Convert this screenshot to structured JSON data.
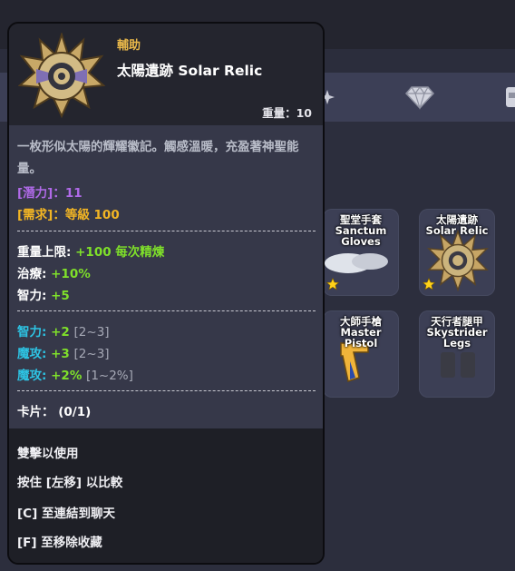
{
  "tooltip": {
    "category": "輔助",
    "item_name": "太陽遺跡 Solar Relic",
    "weight": "重量：10",
    "description": "一枚形似太陽的輝耀徽記。觸感溫暖，充盈著神聖能量。",
    "potential": "[潛力]：11",
    "requirement": "[需求]：等級 100",
    "stats": [
      {
        "label": "重量上限:",
        "value": "+100 每次精煉"
      },
      {
        "label": "治療:",
        "value": "+10%"
      },
      {
        "label": "智力:",
        "value": "+5"
      }
    ],
    "random_stats": [
      {
        "label": "智力:",
        "value": "+2",
        "range": "[2~3]"
      },
      {
        "label": "魔攻:",
        "value": "+3",
        "range": "[2~3]"
      },
      {
        "label": "魔攻:",
        "value": "+2%",
        "range": "[1~2%]"
      }
    ],
    "cards": "卡片： (0/1)",
    "hints": [
      "雙擊以使用",
      "按住 [左移] 以比較",
      "[C] 至連結到聊天",
      "[F] 至移除收藏"
    ]
  },
  "inventory": {
    "slots": [
      {
        "name_line1": "聖堂手套",
        "name_line2": "Sanctum",
        "name_line3": "Gloves",
        "starred": true
      },
      {
        "name_line1": "太陽遺跡",
        "name_line2": "Solar Relic",
        "name_line3": "",
        "starred": true
      },
      {
        "name_line1": "大師手槍",
        "name_line2": "Master Pistol",
        "name_line3": "",
        "starred": false
      },
      {
        "name_line1": "天行者腿甲",
        "name_line2": "Skystrider",
        "name_line3": "Legs",
        "starred": false
      }
    ]
  },
  "colors": {
    "category": "#e9b84a",
    "potential": "#b06ae8",
    "requirement": "#f2b524",
    "stat_value": "#7fe02a",
    "random_stat_label": "#2dc4e4"
  },
  "icons": {
    "item": "solar-relic-icon",
    "tab_icons": [
      "sparkle-icon",
      "gem-icon",
      "bag-icon"
    ],
    "favorite": "star-icon"
  }
}
